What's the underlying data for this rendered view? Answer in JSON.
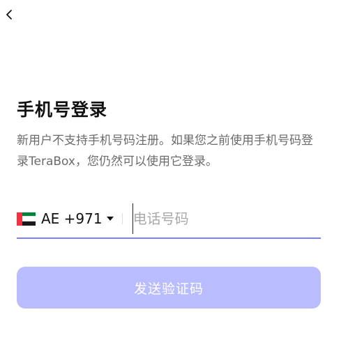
{
  "header": {
    "back_icon": "chevron-left-icon"
  },
  "title": "手机号登录",
  "description": "新用户不支持手机号码注册。如果您之前使用手机号码登录TeraBox，您仍然可以使用它登录。",
  "phone": {
    "flag_icon": "uae-flag-icon",
    "country_code": "AE +971",
    "dropdown_icon": "caret-down-icon",
    "placeholder": "电话号码",
    "value": ""
  },
  "send_button_label": "发送验证码",
  "colors": {
    "accent_underline": "#7b80f5",
    "button_disabled_bg": "#b9bcff",
    "description_text": "#6b6b6b",
    "placeholder_text": "#a9a9a9"
  }
}
